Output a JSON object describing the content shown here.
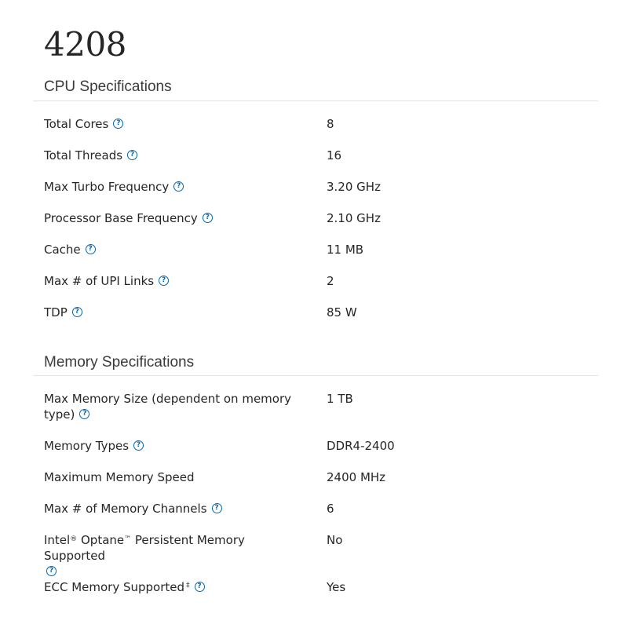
{
  "title": "4208",
  "help_glyph": "?",
  "sections": [
    {
      "heading": "CPU Specifications",
      "rows": [
        {
          "label": "Total Cores",
          "value": "8"
        },
        {
          "label": "Total Threads",
          "value": "16"
        },
        {
          "label": "Max Turbo Frequency",
          "value": "3.20 GHz"
        },
        {
          "label": "Processor Base Frequency",
          "value": "2.10 GHz"
        },
        {
          "label": "Cache",
          "value": "11 MB"
        },
        {
          "label": "Max # of UPI Links",
          "value": "2"
        },
        {
          "label": "TDP",
          "value": "85 W"
        }
      ]
    },
    {
      "heading": "Memory Specifications",
      "rows": [
        {
          "label_line1": "Max Memory Size (dependent on memory",
          "label_line2": "type)",
          "value": "1 TB"
        },
        {
          "label": "Memory Types",
          "value": "DDR4-2400"
        },
        {
          "label": "Maximum Memory Speed",
          "value": "2400 MHz"
        },
        {
          "label": "Max # of Memory Channels",
          "value": "6"
        },
        {
          "label_pre": "Intel",
          "reg": "®",
          "label_mid": " Optane",
          "tm": "™",
          "label_post": " Persistent Memory Supported",
          "value": "No"
        },
        {
          "label": "ECC Memory Supported",
          "dagger": "‡",
          "value": "Yes"
        }
      ]
    }
  ],
  "colors": {
    "accent": "#0068b5",
    "text": "#262626",
    "divider": "#e3e3e3"
  },
  "icons": {
    "help": "question-circle-icon"
  }
}
